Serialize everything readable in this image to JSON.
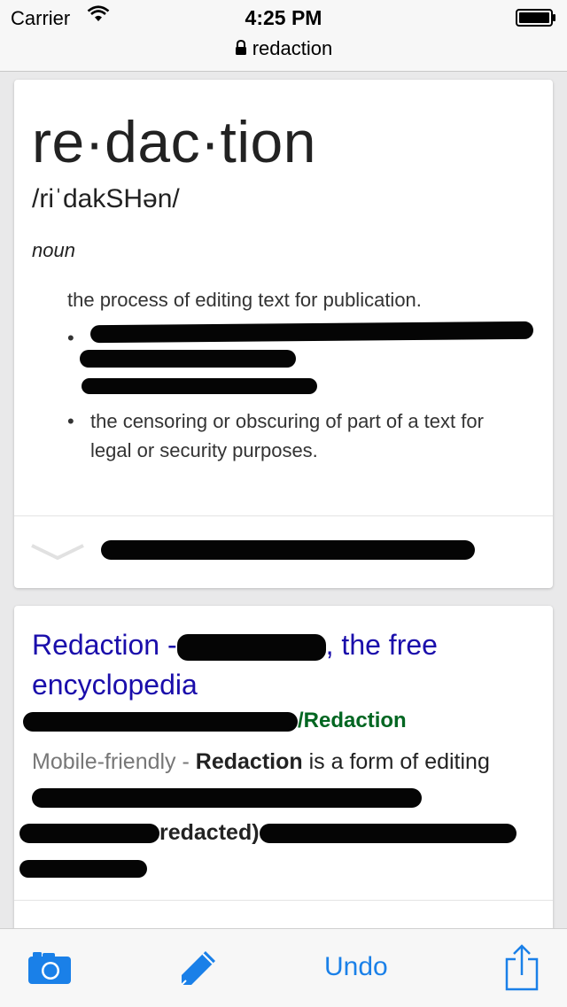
{
  "status": {
    "carrier": "Carrier",
    "time": "4:25 PM"
  },
  "address": {
    "url_label": "redaction"
  },
  "definition_card": {
    "headword": "re·dac·tion",
    "pronunciation": "/riˈdakSHən/",
    "part_of_speech": "noun",
    "definition_1": "the process of editing text for publication.",
    "definition_3": "the censoring or obscuring of part of a text for legal or security purposes."
  },
  "result_card": {
    "title_prefix": "Redaction -",
    "title_suffix": ", the free encyclopedia",
    "url_suffix": "/Redaction",
    "mobile_friendly": "Mobile-friendly -",
    "snippet_bold": "Redaction",
    "snippet_text": " is a form of editing",
    "snippet_mid": "redacted)"
  },
  "toolbar": {
    "undo_label": "Undo",
    "icons": [
      "camera-icon",
      "pencil-icon",
      "share-icon"
    ],
    "accent_color": "#1a80e8"
  }
}
